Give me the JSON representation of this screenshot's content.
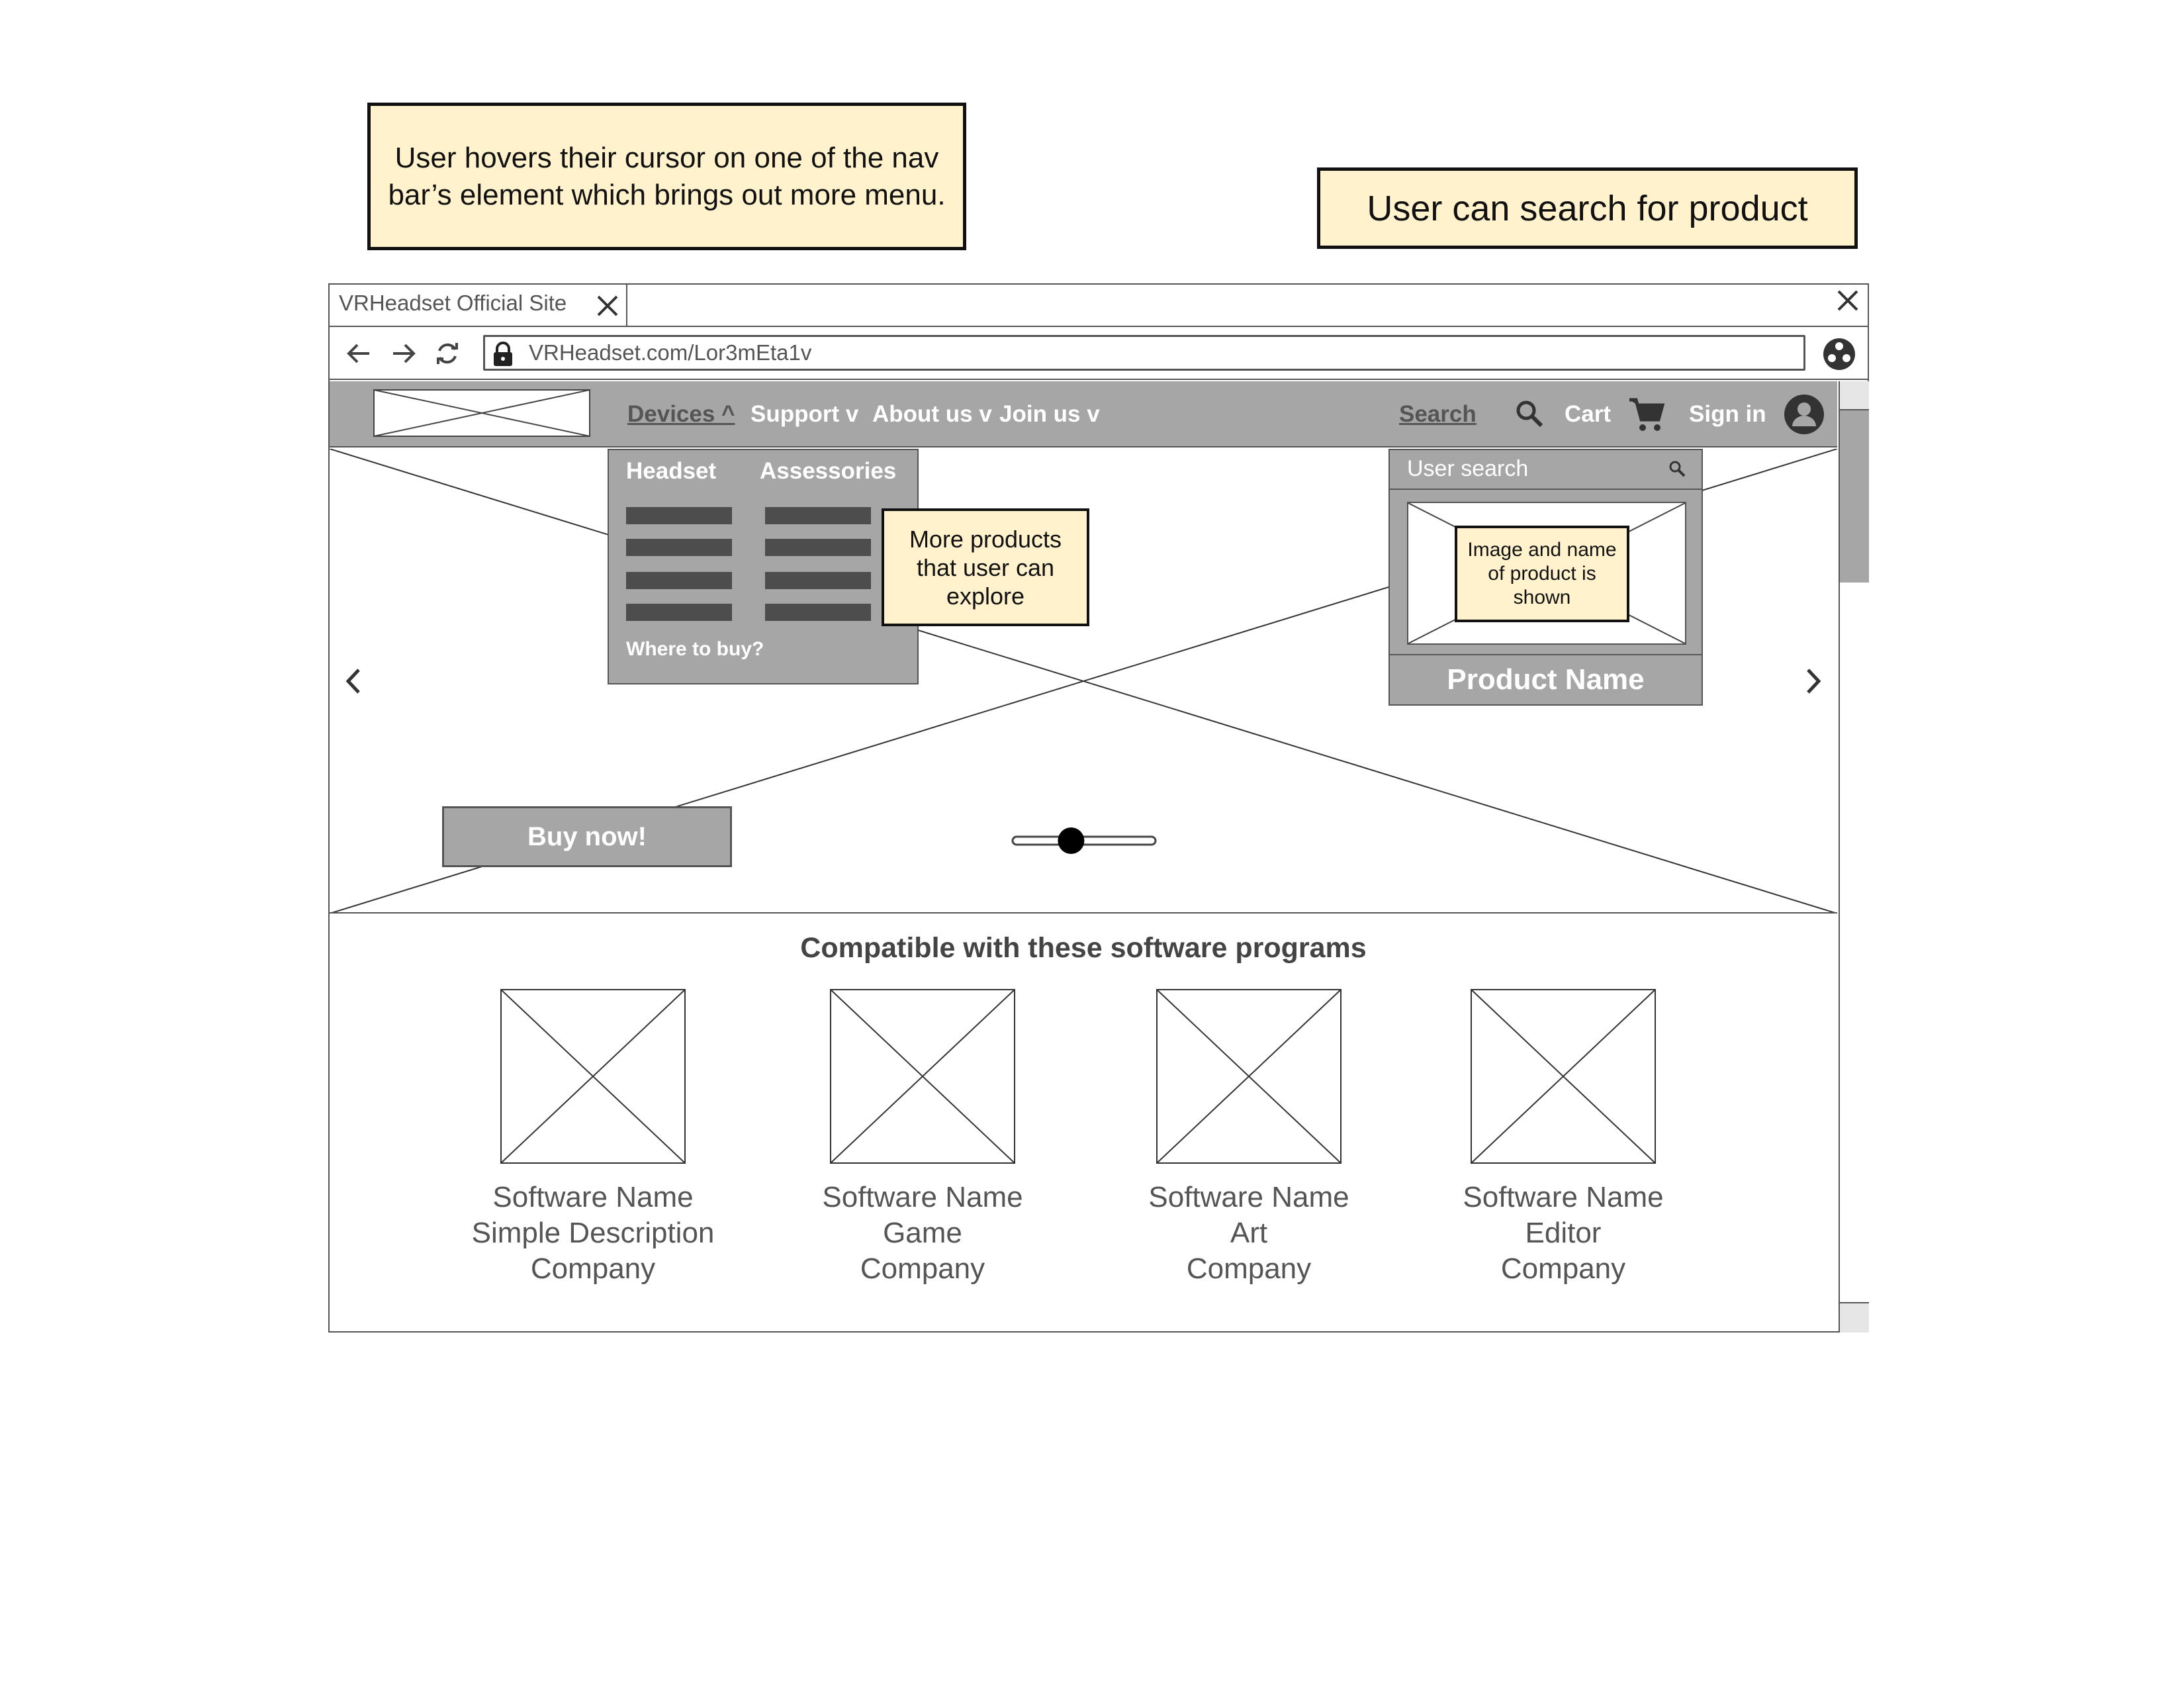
{
  "annotations": {
    "hover_note": "User hovers their cursor on one of the nav bar’s element which brings out more menu.",
    "search_note": "User can search for product",
    "dropdown_note": "More products that user can explore",
    "result_note": "Image and name of product is shown"
  },
  "browser": {
    "tab_title": "VRHeadset Official Site",
    "url": "VRHeadset.com/Lor3mEta1v"
  },
  "nav": {
    "items": [
      {
        "label": "Devices ^"
      },
      {
        "label": "Support v"
      },
      {
        "label": "About us v"
      },
      {
        "label": "Join us v"
      }
    ],
    "search_label": "Search",
    "cart_label": "Cart",
    "signin_label": "Sign in"
  },
  "dropdown": {
    "col1_title": "Headset",
    "col2_title": "Assessories",
    "where_to_buy": "Where to buy?"
  },
  "search_panel": {
    "placeholder": "User search",
    "result_name": "Product Name"
  },
  "hero": {
    "buy_label": "Buy now!",
    "slider_value": 0.4
  },
  "software": {
    "title": "Compatible with these software programs",
    "items": [
      {
        "name": "Software Name",
        "desc": "Simple Description",
        "company": "Company"
      },
      {
        "name": "Software Name",
        "desc": "Game",
        "company": "Company"
      },
      {
        "name": "Software Name",
        "desc": "Art",
        "company": "Company"
      },
      {
        "name": "Software Name",
        "desc": "Editor",
        "company": "Company"
      }
    ]
  },
  "colors": {
    "note_bg": "#fff2cc",
    "nav_bg": "#a6a6a6",
    "dark_bar": "#4d4d4d"
  }
}
